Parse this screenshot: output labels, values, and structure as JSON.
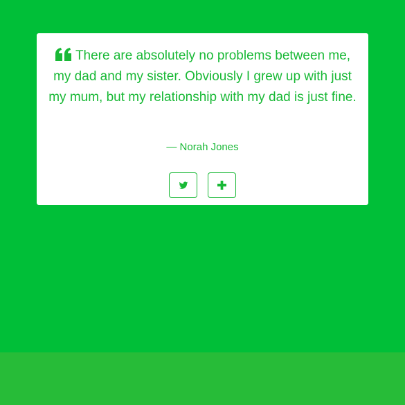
{
  "colors": {
    "background": "#00bf38",
    "footer": "#27bc38",
    "accent": "#19b936",
    "card": "#ffffff"
  },
  "quote": {
    "icon": "quote-left-icon",
    "text": "There are absolutely no problems between me, my dad and my sister. Obviously I grew up with just my mum, but my relationship with my dad is just fine.",
    "author": "— Norah Jones"
  },
  "buttons": {
    "tweet_icon": "twitter-icon",
    "new_quote_icon": "plus-icon"
  }
}
